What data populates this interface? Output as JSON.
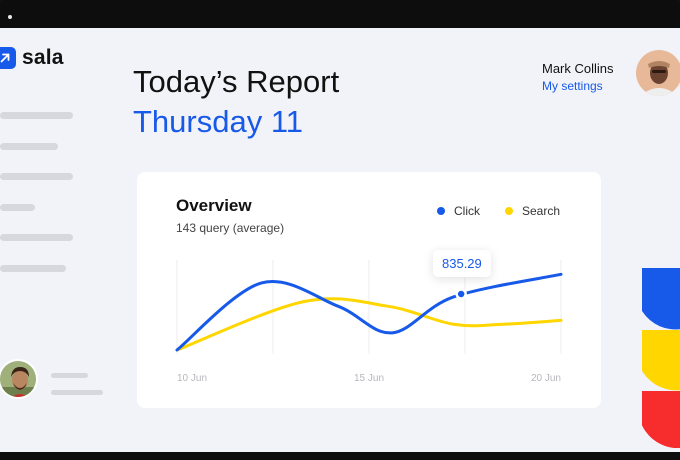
{
  "brand": {
    "name": "sala"
  },
  "header": {
    "title": "Today’s Report",
    "subtitle": "Thursday 11"
  },
  "user": {
    "name": "Mark Collins",
    "settings_link": "My settings"
  },
  "overview": {
    "title": "Overview",
    "summary": "143 query (average)",
    "tooltip_value": "835.29",
    "x_labels": [
      "10 Jun",
      "15 Jun",
      "20 Jun"
    ]
  },
  "colors": {
    "accent": "#1759e8",
    "search": "#ffd600",
    "deco_red": "#f72c2c"
  },
  "chart_data": {
    "type": "line",
    "title": "Overview",
    "x_tick_labels": [
      "10 Jun",
      "15 Jun",
      "20 Jun"
    ],
    "legend_position": "top-right",
    "grid": "vertical lines",
    "series": [
      {
        "name": "Click",
        "color": "#1759e8",
        "values": [
          [
            0,
            0.0
          ],
          [
            0.22,
            0.86
          ],
          [
            0.42,
            0.56
          ],
          [
            0.56,
            0.22
          ],
          [
            0.72,
            0.68
          ],
          [
            1.0,
            0.97
          ]
        ]
      },
      {
        "name": "Search",
        "color": "#ffd600",
        "values": [
          [
            0,
            0.0
          ],
          [
            0.33,
            0.62
          ],
          [
            0.55,
            0.56
          ],
          [
            0.72,
            0.33
          ],
          [
            0.85,
            0.33
          ],
          [
            1.0,
            0.38
          ]
        ]
      }
    ],
    "highlight": {
      "series": "Click",
      "x": 0.74,
      "label": "835.29"
    }
  }
}
